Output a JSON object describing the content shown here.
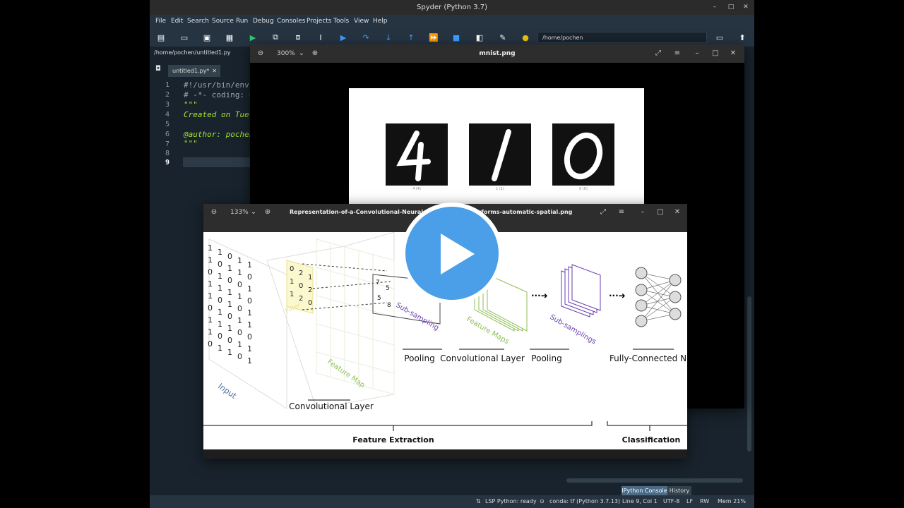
{
  "spyder": {
    "title": "Spyder (Python 3.7)",
    "menu": [
      "File",
      "Edit",
      "Search",
      "Source",
      "Run",
      "Debug",
      "Consoles",
      "Projects",
      "Tools",
      "View",
      "Help"
    ],
    "path": "/home/pochen",
    "file_path": "/home/pochen/untitled1.py",
    "tab_label": "untitled1.py*",
    "line_numbers": [
      "1",
      "2",
      "3",
      "4",
      "5",
      "6",
      "7",
      "8",
      "9"
    ],
    "code_lines": [
      "#!/usr/bin/env",
      "# -*- coding: u",
      "\"\"\"",
      "Created on Tue",
      "",
      "@author: pochen",
      "\"\"\"",
      "",
      ""
    ],
    "console_tabs": [
      "IPython Console",
      "History"
    ],
    "status": {
      "lsp": "LSP Python: ready",
      "conda": "conda: tf (Python 3.7.13)",
      "position": "Line 9, Col 1",
      "encoding": "UTF-8",
      "eol": "LF",
      "rw": "RW",
      "mem": "Mem 21%"
    }
  },
  "mnist_viewer": {
    "title": "mnist.png",
    "zoom": "300%",
    "digits": [
      "4",
      "1",
      "0"
    ],
    "digit_labels": [
      "4 (4)",
      "1 (1)",
      "0 (0)"
    ]
  },
  "cnn_viewer": {
    "title": "Representation-of-a-Convolutional-Neural-Network-CNN-performs-automatic-spatial.png",
    "zoom": "133%",
    "figure": {
      "labels": {
        "input": "Input",
        "filter": "Filter",
        "feature_map": "Feature Map",
        "sub_sampling": "Sub-sampling",
        "feature_maps": "Feature Maps",
        "sub_samplings": "Sub-samplings",
        "convolutional_layer": "Convolutional Layer",
        "pooling_1": "Pooling",
        "convolutional_layer_2": "Convolutional Layer",
        "pooling_2": "Pooling",
        "fully_connected": "Fully-Connected NN",
        "feature_extraction": "Feature Extraction",
        "classification": "Classification"
      },
      "filter_values": [
        "0",
        "2",
        "1",
        "1",
        "0",
        "2",
        "1",
        "2",
        "0"
      ],
      "pooled_values": [
        "7",
        "5",
        "5",
        "8"
      ],
      "input_columns": [
        [
          "1",
          "1",
          "0",
          "1",
          "1",
          "0",
          "1",
          "1",
          "0"
        ],
        [
          "1",
          "0",
          "1",
          "1",
          "0",
          "1",
          "1",
          "0",
          "1"
        ],
        [
          "0",
          "1",
          "0",
          "1",
          "1",
          "0",
          "1",
          "0",
          "1"
        ],
        [
          "1",
          "1",
          "0",
          "1",
          "0",
          "1",
          "0",
          "1",
          "0"
        ],
        [
          "1",
          "0",
          "1",
          "0",
          "1",
          "1",
          "0",
          "1",
          "1"
        ]
      ]
    }
  },
  "colors": {
    "spyder_bg": "#19232d",
    "spyder_bar": "#263442",
    "play_button": "#4b9fe8",
    "filter_yellow": "#e8e28a",
    "feature_green": "#8fbf5a",
    "subsample_purple": "#6a3fb0"
  }
}
